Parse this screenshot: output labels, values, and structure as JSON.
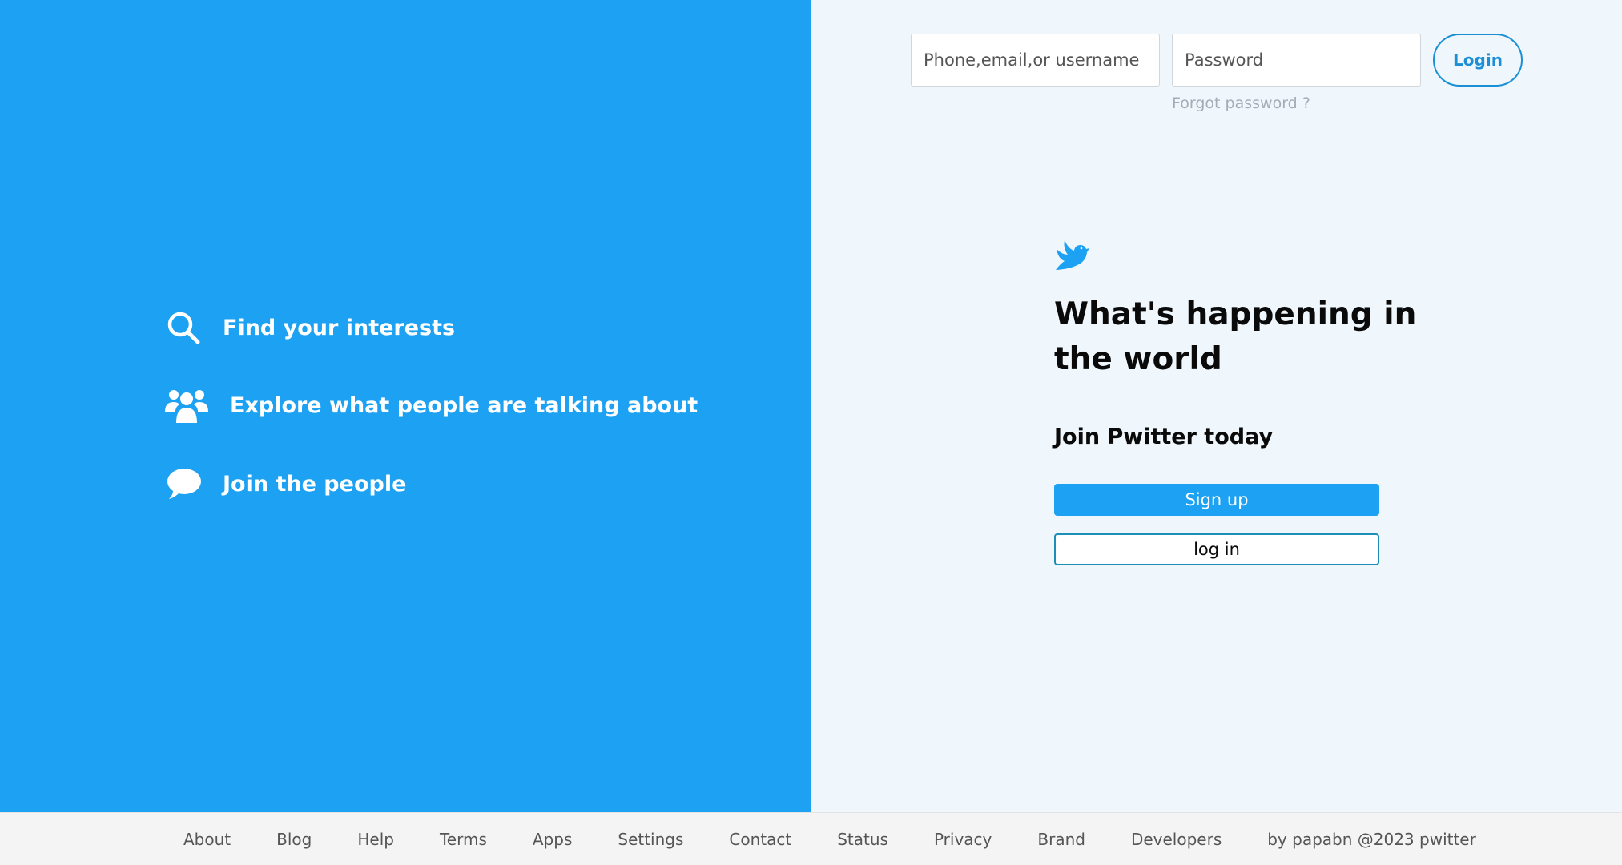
{
  "features": [
    {
      "icon": "search-icon",
      "label": "Find your interests"
    },
    {
      "icon": "people-icon",
      "label": "Explore what people are talking about"
    },
    {
      "icon": "chat-bubble-icon",
      "label": "Join the people"
    }
  ],
  "login_bar": {
    "username_placeholder": "Phone,email,or username",
    "password_placeholder": "Password",
    "login_label": "Login",
    "forgot_label": "Forgot password ?"
  },
  "hero": {
    "logo_icon": "bird-icon",
    "headline": "What's happening in the world",
    "subhead": "Join Pwitter today",
    "signup_label": "Sign up",
    "login_label": "log in"
  },
  "footer": {
    "links": [
      "About",
      "Blog",
      "Help",
      "Terms",
      "Apps",
      "Settings",
      "Contact",
      "Status",
      "Privacy",
      "Brand",
      "Developers"
    ],
    "credit": "by papabn @2023 pwitter"
  },
  "colors": {
    "brand_blue": "#1da1f2",
    "panel_bg": "#f0f7fc",
    "footer_bg": "#f4f4f4"
  }
}
